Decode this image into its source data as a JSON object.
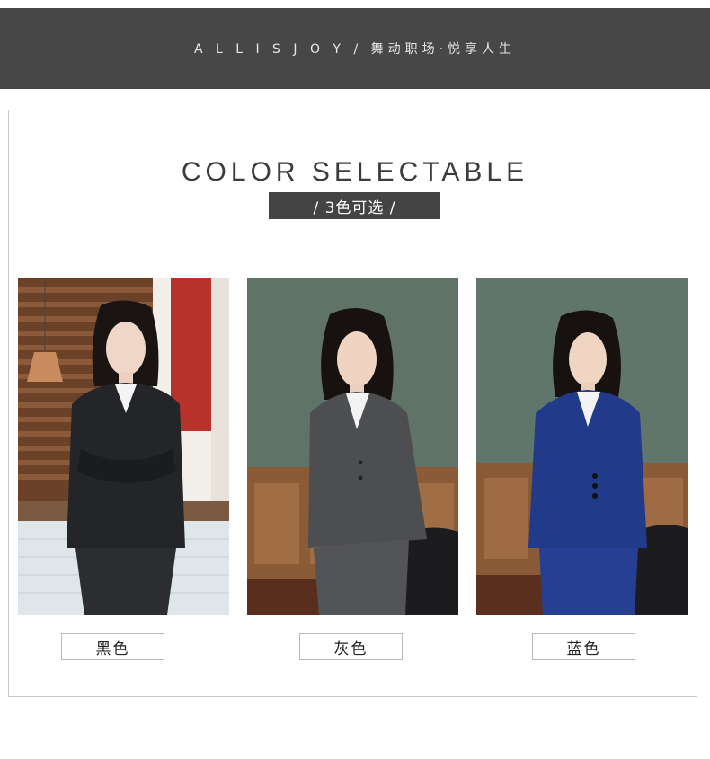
{
  "header": {
    "brand": "A L L I S J O Y",
    "separator": "/",
    "slogan": "舞动职场·悦享人生"
  },
  "section": {
    "title": "COLOR SELECTABLE",
    "subtitle": "/ 3色可选 /"
  },
  "colors": [
    {
      "label": "黑色",
      "suit_color": "#232528"
    },
    {
      "label": "灰色",
      "suit_color": "#4d4e52"
    },
    {
      "label": "蓝色",
      "suit_color": "#223a8a"
    }
  ]
}
